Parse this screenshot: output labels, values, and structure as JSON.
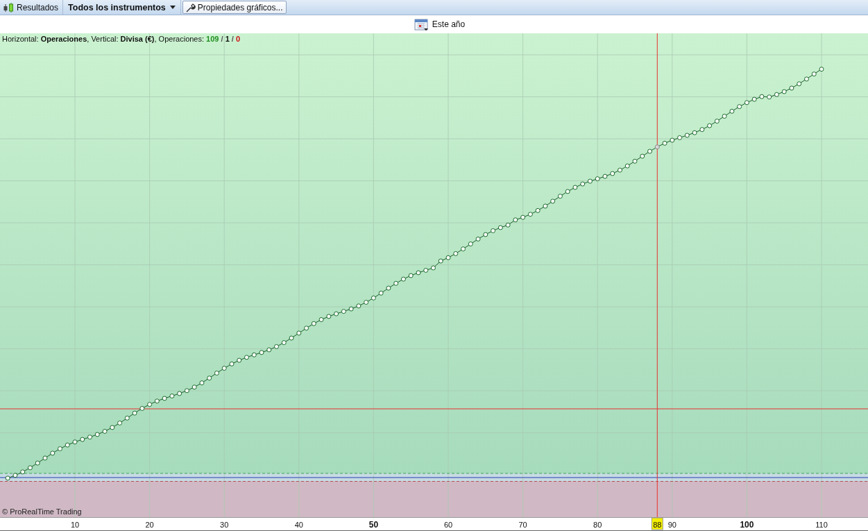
{
  "toolbar": {
    "items": [
      {
        "kind": "tab",
        "label": "Resultados"
      },
      {
        "kind": "dropdown",
        "label": "Todos los instrumentos"
      },
      {
        "kind": "button",
        "label": "Propiedades gráficos..."
      }
    ]
  },
  "period": {
    "label": "Este año"
  },
  "chart": {
    "info": "Horizontal: **Operaciones**, Vertical: **Divisa (€)**, Operaciones: ",
    "counts": [
      {
        "value": "109",
        "color": "#1f8f1f"
      },
      {
        "value": "1",
        "color": "#111111"
      },
      {
        "value": "0",
        "color": "#cc1111"
      }
    ],
    "separator": "/",
    "copyright": "© ProRealTime Trading",
    "x_axis": [
      {
        "text": "10",
        "major": false
      },
      {
        "text": "20",
        "major": false
      },
      {
        "text": "30",
        "major": false
      },
      {
        "text": "40",
        "major": false
      },
      {
        "text": "50",
        "major": true
      },
      {
        "text": "60",
        "major": false
      },
      {
        "text": "70",
        "major": false
      },
      {
        "text": "80",
        "major": false
      },
      {
        "text": "90",
        "major": false
      },
      {
        "text": "100",
        "major": true
      },
      {
        "text": "110",
        "major": false
      }
    ],
    "cursor": {
      "label": "88"
    }
  }
}
